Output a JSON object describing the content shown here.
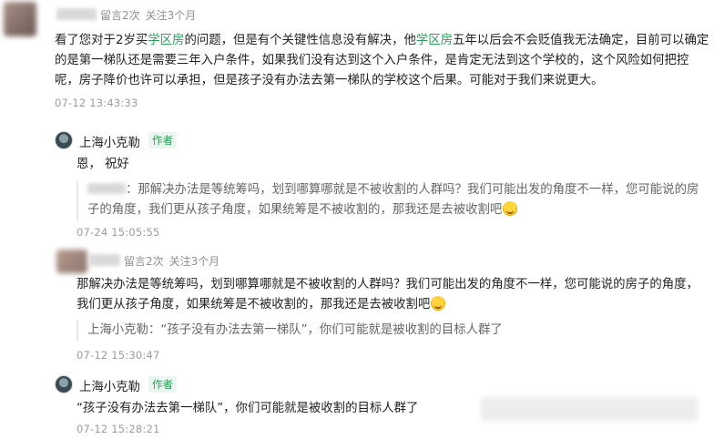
{
  "comment1": {
    "meta": {
      "replies": "留言2次",
      "follow": "关注3个月"
    },
    "text_parts": [
      "看了您对于2岁买",
      "学区房",
      "的问题，但是有个关键性信息没有解决，他",
      "学区房",
      "五年以后会不会贬值我无法确定，目前可以确定的是第一梯队还是需要三年入户条件，如果我们没有达到这个入户条件，是肯定无法到这个学校的，这个风险如何把控呢，房子降价也许可以承担，但是孩子没有办法去第一梯队的学校这个后果。可能对于我们来说更大。"
    ],
    "time": "07-12 13:43:33"
  },
  "reply1": {
    "author": "上海小克勒",
    "badge": "作者",
    "text": "恩， 祝好",
    "quote_text": "：那解决办法是等统筹吗，划到哪算哪就是不被收割的人群吗？我们可能出发的角度不一样，您可能说的房子的角度，我们更从孩子角度，如果统筹是不被收割的，那我还是去被收割吧",
    "time": "07-24 15:05:55"
  },
  "comment2": {
    "meta": {
      "replies": "留言2次",
      "follow": "关注3个月"
    },
    "text": "那解决办法是等统筹吗，划到哪算哪就是不被收割的人群吗？我们可能出发的角度不一样，您可能说的房子的角度，我们更从孩子角度，如果统筹是不被收割的，那我还是去被收割吧",
    "quote_name": "上海小克勒：",
    "quote_text": "“孩子没有办法去第一梯队”，你们可能就是被收割的目标人群了",
    "time": "07-12 15:30:47"
  },
  "reply2": {
    "author": "上海小克勒",
    "badge": "作者",
    "text": "“孩子没有办法去第一梯队”，你们可能就是被收割的目标人群了",
    "time": "07-12 15:28:21"
  },
  "colors": {
    "accent": "#2aa157",
    "meta": "#8f8f8f",
    "text": "#222222"
  },
  "icons": {
    "emoji": "grin-sweat-emoji-icon",
    "author_avatar": "author-avatar-icon"
  }
}
